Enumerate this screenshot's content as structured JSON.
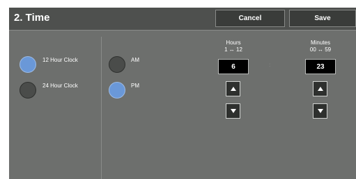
{
  "header": {
    "title": "2. Time",
    "cancel_label": "Cancel",
    "save_label": "Save"
  },
  "clock_format": {
    "options": [
      {
        "label": "12 Hour Clock",
        "selected": true
      },
      {
        "label": "24 Hour Clock",
        "selected": false
      }
    ]
  },
  "meridiem": {
    "options": [
      {
        "label": "AM",
        "selected": false
      },
      {
        "label": "PM",
        "selected": true
      }
    ]
  },
  "hours": {
    "label": "Hours",
    "range": "1 ↔ 12",
    "value": "6"
  },
  "minutes": {
    "label": "Minutes",
    "range": "00 ↔ 59",
    "value": "23"
  },
  "separator": ":",
  "colors": {
    "panel": "#6d6f6d",
    "header": "#4e504e",
    "selected_radio": "#6a98d8",
    "unselected_radio": "#4a4c4a"
  }
}
